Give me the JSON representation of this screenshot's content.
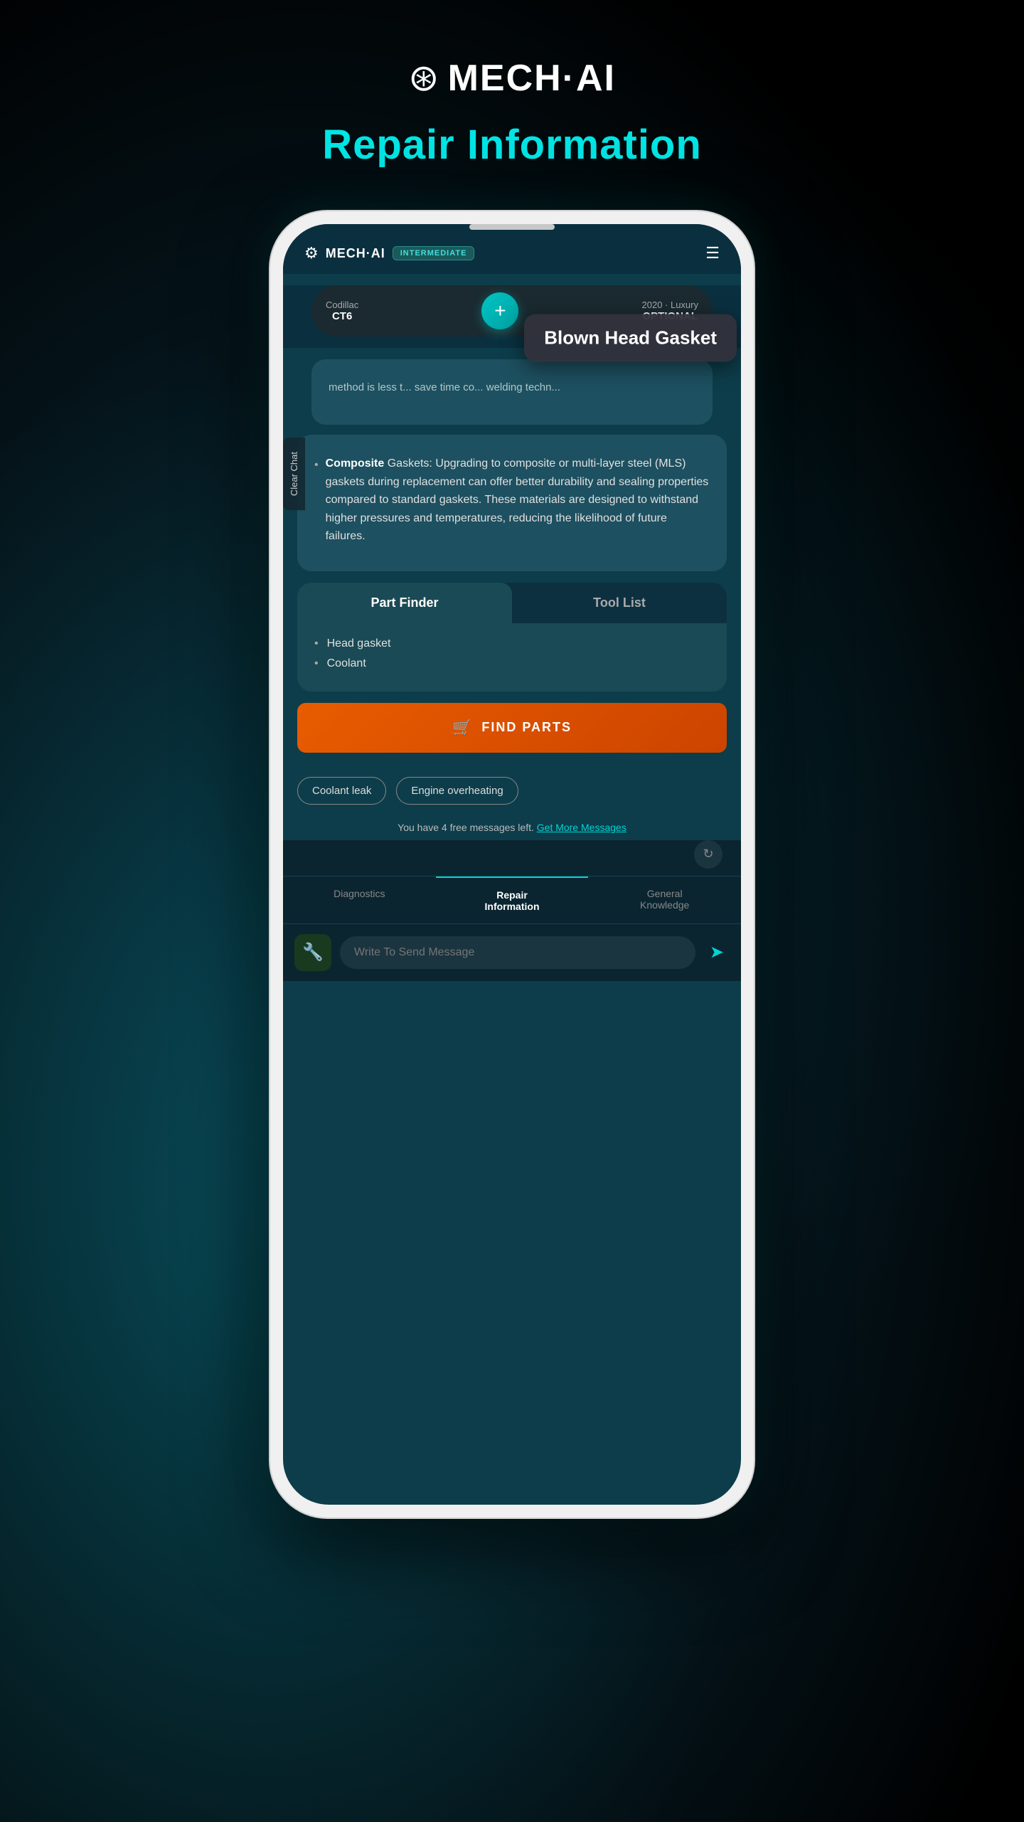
{
  "header": {
    "logo_icon": "⚙",
    "logo_name": "MECH·AI",
    "page_title": "Repair Information"
  },
  "app": {
    "logo_name": "MECH·AI",
    "badge": "INTERMEDIATE",
    "hamburger": "☰",
    "vehicle_left_label": "Codillac",
    "vehicle_left_sub": "CT6",
    "vehicle_right_label": "2020 · Luxury",
    "vehicle_right_sub": "OPTIONAL",
    "add_button": "+",
    "clear_chat": "Clear Chat"
  },
  "tooltip": {
    "text": "Blown Head Gasket"
  },
  "chat": {
    "partial_text": "method is less t... save time co... welding techn...",
    "bullet_label": "Composite",
    "bullet_rest": " Gaskets:",
    "bullet_body": "Upgrading to composite or multi-layer steel (MLS) gaskets during replacement can offer better durability and sealing properties compared to standard gaskets. These materials are designed to withstand higher pressures and temperatures, reducing the likelihood of future failures."
  },
  "part_finder": {
    "tab_active": "Part Finder",
    "tab_inactive": "Tool List",
    "parts": [
      "Head gasket",
      "Coolant"
    ],
    "find_parts_label": "FIND PARTS"
  },
  "chips": [
    "Coolant leak",
    "Engine overheating"
  ],
  "free_messages": {
    "text": "You have 4 free messages left.",
    "link": "Get More Messages"
  },
  "bottom_nav": [
    {
      "label": "Diagnostics",
      "active": false
    },
    {
      "label": "Repair\nInformation",
      "active": true
    },
    {
      "label": "General\nKnowledge",
      "active": false
    }
  ],
  "input": {
    "placeholder": "Write To Send Message"
  }
}
